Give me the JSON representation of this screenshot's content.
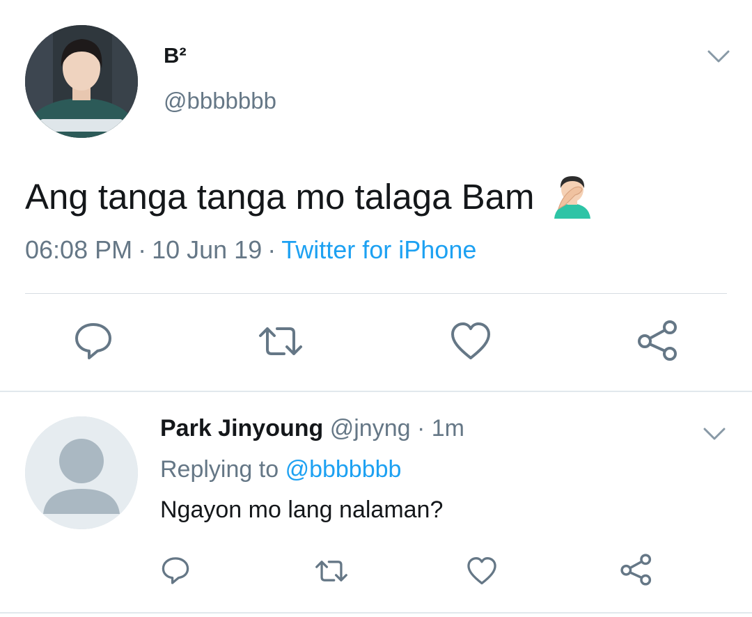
{
  "tweet": {
    "display_name": "B²",
    "handle": "@bbbbbbb",
    "text": "Ang tanga tanga mo talaga Bam",
    "emoji": "man-facepalming-emoji",
    "time": "06:08 PM",
    "date": "10 Jun 19",
    "separator": "·",
    "source": "Twitter for iPhone",
    "actions": [
      "reply-icon",
      "retweet-icon",
      "like-icon",
      "share-icon"
    ]
  },
  "reply": {
    "display_name": "Park Jinyoung",
    "handle": "@jnyng",
    "separator": "·",
    "age": "1m",
    "replying_prefix": "Replying to",
    "replying_to": "@bbbbbbb",
    "text": "Ngayon mo lang nalaman?",
    "actions": [
      "reply-icon",
      "retweet-icon",
      "like-icon",
      "share-icon"
    ]
  },
  "colors": {
    "text": "#14171a",
    "secondary": "#657786",
    "link": "#1da1f2",
    "icon": "#657786",
    "divider": "#e1e8ed"
  }
}
